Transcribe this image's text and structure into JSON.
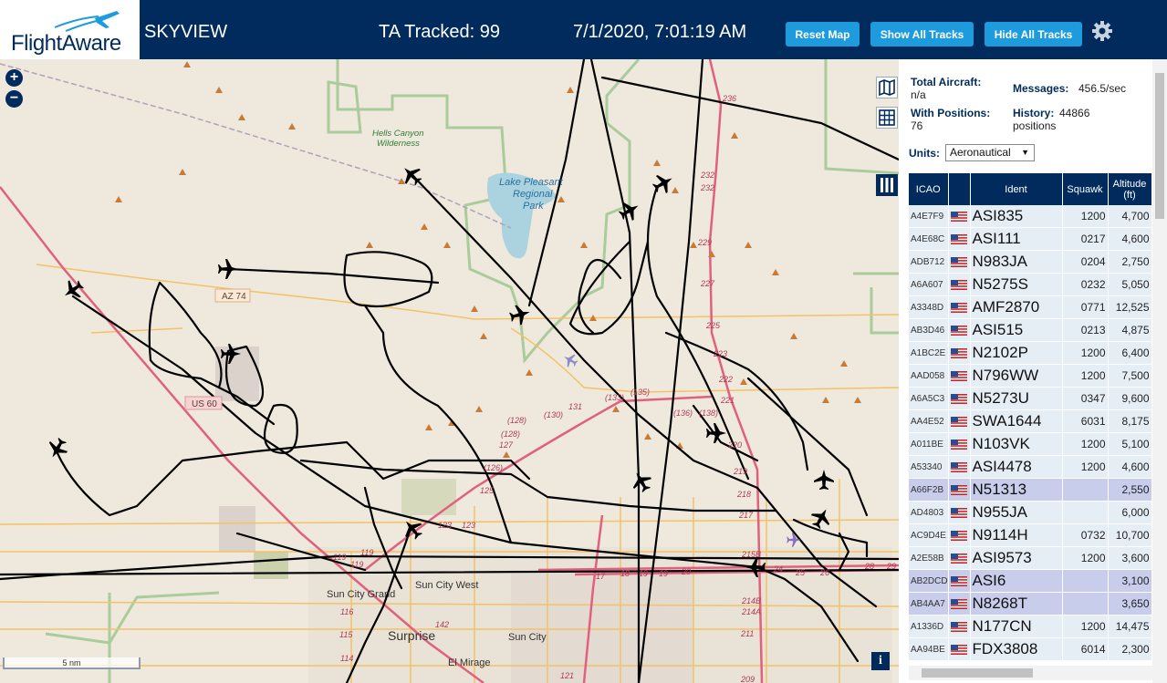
{
  "header": {
    "logo_text": "FlightAware",
    "app_title": "SKYVIEW",
    "ta_tracked": "TA Tracked: 99",
    "clock": "7/1/2020, 7:01:19 AM",
    "reset_map": "Reset Map",
    "show_all_tracks": "Show All Tracks",
    "hide_all_tracks": "Hide All Tracks",
    "settings_icon": "gear-icon"
  },
  "map": {
    "zoom_in": "+",
    "zoom_out": "−",
    "scale_label": "5 nm",
    "info": "i",
    "labels": {
      "hells_canyon": [
        "Hells Canyon",
        "Wilderness"
      ],
      "lake_pleasant": [
        "Lake Pleasant",
        "Regional",
        "Park"
      ],
      "az74": "AZ 74",
      "us60": "US 60",
      "sun_city_west": "Sun City West",
      "sun_city_grand": "Sun City Grand",
      "surprise": "Surprise",
      "sun_city": "Sun City",
      "el_mirage": "El Mirage",
      "r236": "236",
      "r232a": "232",
      "r232b": "232",
      "r229": "229",
      "r227": "227",
      "r225": "225",
      "r223": "223",
      "r222": "222",
      "r221": "221",
      "r220": "220",
      "r219": "219",
      "r218": "218",
      "r217": "217",
      "r215b": "215B",
      "r214b": "214B",
      "r214a": "214A",
      "r211": "211",
      "r209": "209",
      "r133": "(133)",
      "r135": "(135)",
      "r131": "131",
      "r130": "(130)",
      "r128": "(128)",
      "r127": "127",
      "r128b": "(128)",
      "r126": "(126)",
      "r125": "125",
      "r123a": "123",
      "r123b": "123",
      "r119a": "119",
      "r119b": "119",
      "r116": "116",
      "r115": "115",
      "r114": "114",
      "r142": "142",
      "r136": "(136)",
      "r138": "(138)",
      "r17": "17",
      "r18": "18",
      "r19a": "19",
      "r19b": "19",
      "r20": "20",
      "r24": "24",
      "r25": "25",
      "r26": "26",
      "r28": "28",
      "r29": "29",
      "r121": "121",
      "r119c": "119"
    }
  },
  "stats": {
    "total_aircraft_label": "Total Aircraft:",
    "total_aircraft_value": "n/a",
    "with_positions_label": "With Positions:",
    "with_positions_value": "76",
    "messages_label": "Messages:",
    "messages_value": "456.5/sec",
    "history_label": "History:",
    "history_value_1": "44866",
    "history_value_2": "positions"
  },
  "units": {
    "label": "Units:",
    "selected": "Aeronautical"
  },
  "table": {
    "headers": {
      "icao": "ICAO",
      "flag": "",
      "ident": "Ident",
      "squawk": "Squawk",
      "altitude_1": "Altitude",
      "altitude_2": "(ft)"
    },
    "rows": [
      {
        "icao": "A4E7F9",
        "ident": "ASI835",
        "squawk": "1200",
        "altitude": "4,700",
        "selected": false
      },
      {
        "icao": "A4E68C",
        "ident": "ASI111",
        "squawk": "0217",
        "altitude": "4,600",
        "selected": false
      },
      {
        "icao": "ADB712",
        "ident": "N983JA",
        "squawk": "0204",
        "altitude": "2,750",
        "selected": false
      },
      {
        "icao": "A6A607",
        "ident": "N5275S",
        "squawk": "0232",
        "altitude": "5,050",
        "selected": false
      },
      {
        "icao": "A3348D",
        "ident": "AMF2870",
        "squawk": "0771",
        "altitude": "12,525",
        "selected": false
      },
      {
        "icao": "AB3D46",
        "ident": "ASI515",
        "squawk": "0213",
        "altitude": "4,875",
        "selected": false
      },
      {
        "icao": "A1BC2E",
        "ident": "N2102P",
        "squawk": "1200",
        "altitude": "6,400",
        "selected": false
      },
      {
        "icao": "AAD058",
        "ident": "N796WW",
        "squawk": "1200",
        "altitude": "7,500",
        "selected": false
      },
      {
        "icao": "A6A5C3",
        "ident": "N5273U",
        "squawk": "0347",
        "altitude": "9,600",
        "selected": false
      },
      {
        "icao": "AA4E52",
        "ident": "SWA1644",
        "squawk": "6031",
        "altitude": "8,175",
        "selected": false
      },
      {
        "icao": "A011BE",
        "ident": "N103VK",
        "squawk": "1200",
        "altitude": "5,100",
        "selected": false
      },
      {
        "icao": "A53340",
        "ident": "ASI4478",
        "squawk": "1200",
        "altitude": "4,600",
        "selected": false
      },
      {
        "icao": "A66F2B",
        "ident": "N51313",
        "squawk": "",
        "altitude": "2,550",
        "selected": true
      },
      {
        "icao": "AD4803",
        "ident": "N955JA",
        "squawk": "",
        "altitude": "6,000",
        "selected": false
      },
      {
        "icao": "AC9D4E",
        "ident": "N9114H",
        "squawk": "0732",
        "altitude": "10,700",
        "selected": false
      },
      {
        "icao": "A2E58B",
        "ident": "ASI9573",
        "squawk": "1200",
        "altitude": "3,600",
        "selected": false
      },
      {
        "icao": "AB2DCD",
        "ident": "ASI6",
        "squawk": "",
        "altitude": "3,100",
        "selected": true
      },
      {
        "icao": "AB4AA7",
        "ident": "N8268T",
        "squawk": "",
        "altitude": "3,650",
        "selected": true
      },
      {
        "icao": "A1336D",
        "ident": "N177CN",
        "squawk": "1200",
        "altitude": "14,475",
        "selected": false
      },
      {
        "icao": "AA94BE",
        "ident": "FDX3808",
        "squawk": "6014",
        "altitude": "2,300",
        "selected": false
      }
    ]
  },
  "colors": {
    "header_bg": "#002b5c",
    "button_bg": "#1e9bdc",
    "track": "#000000",
    "road_major": "#e0607e",
    "road_minor": "#f2c265",
    "park_border": "#9ec78f",
    "water": "#aad3df"
  }
}
